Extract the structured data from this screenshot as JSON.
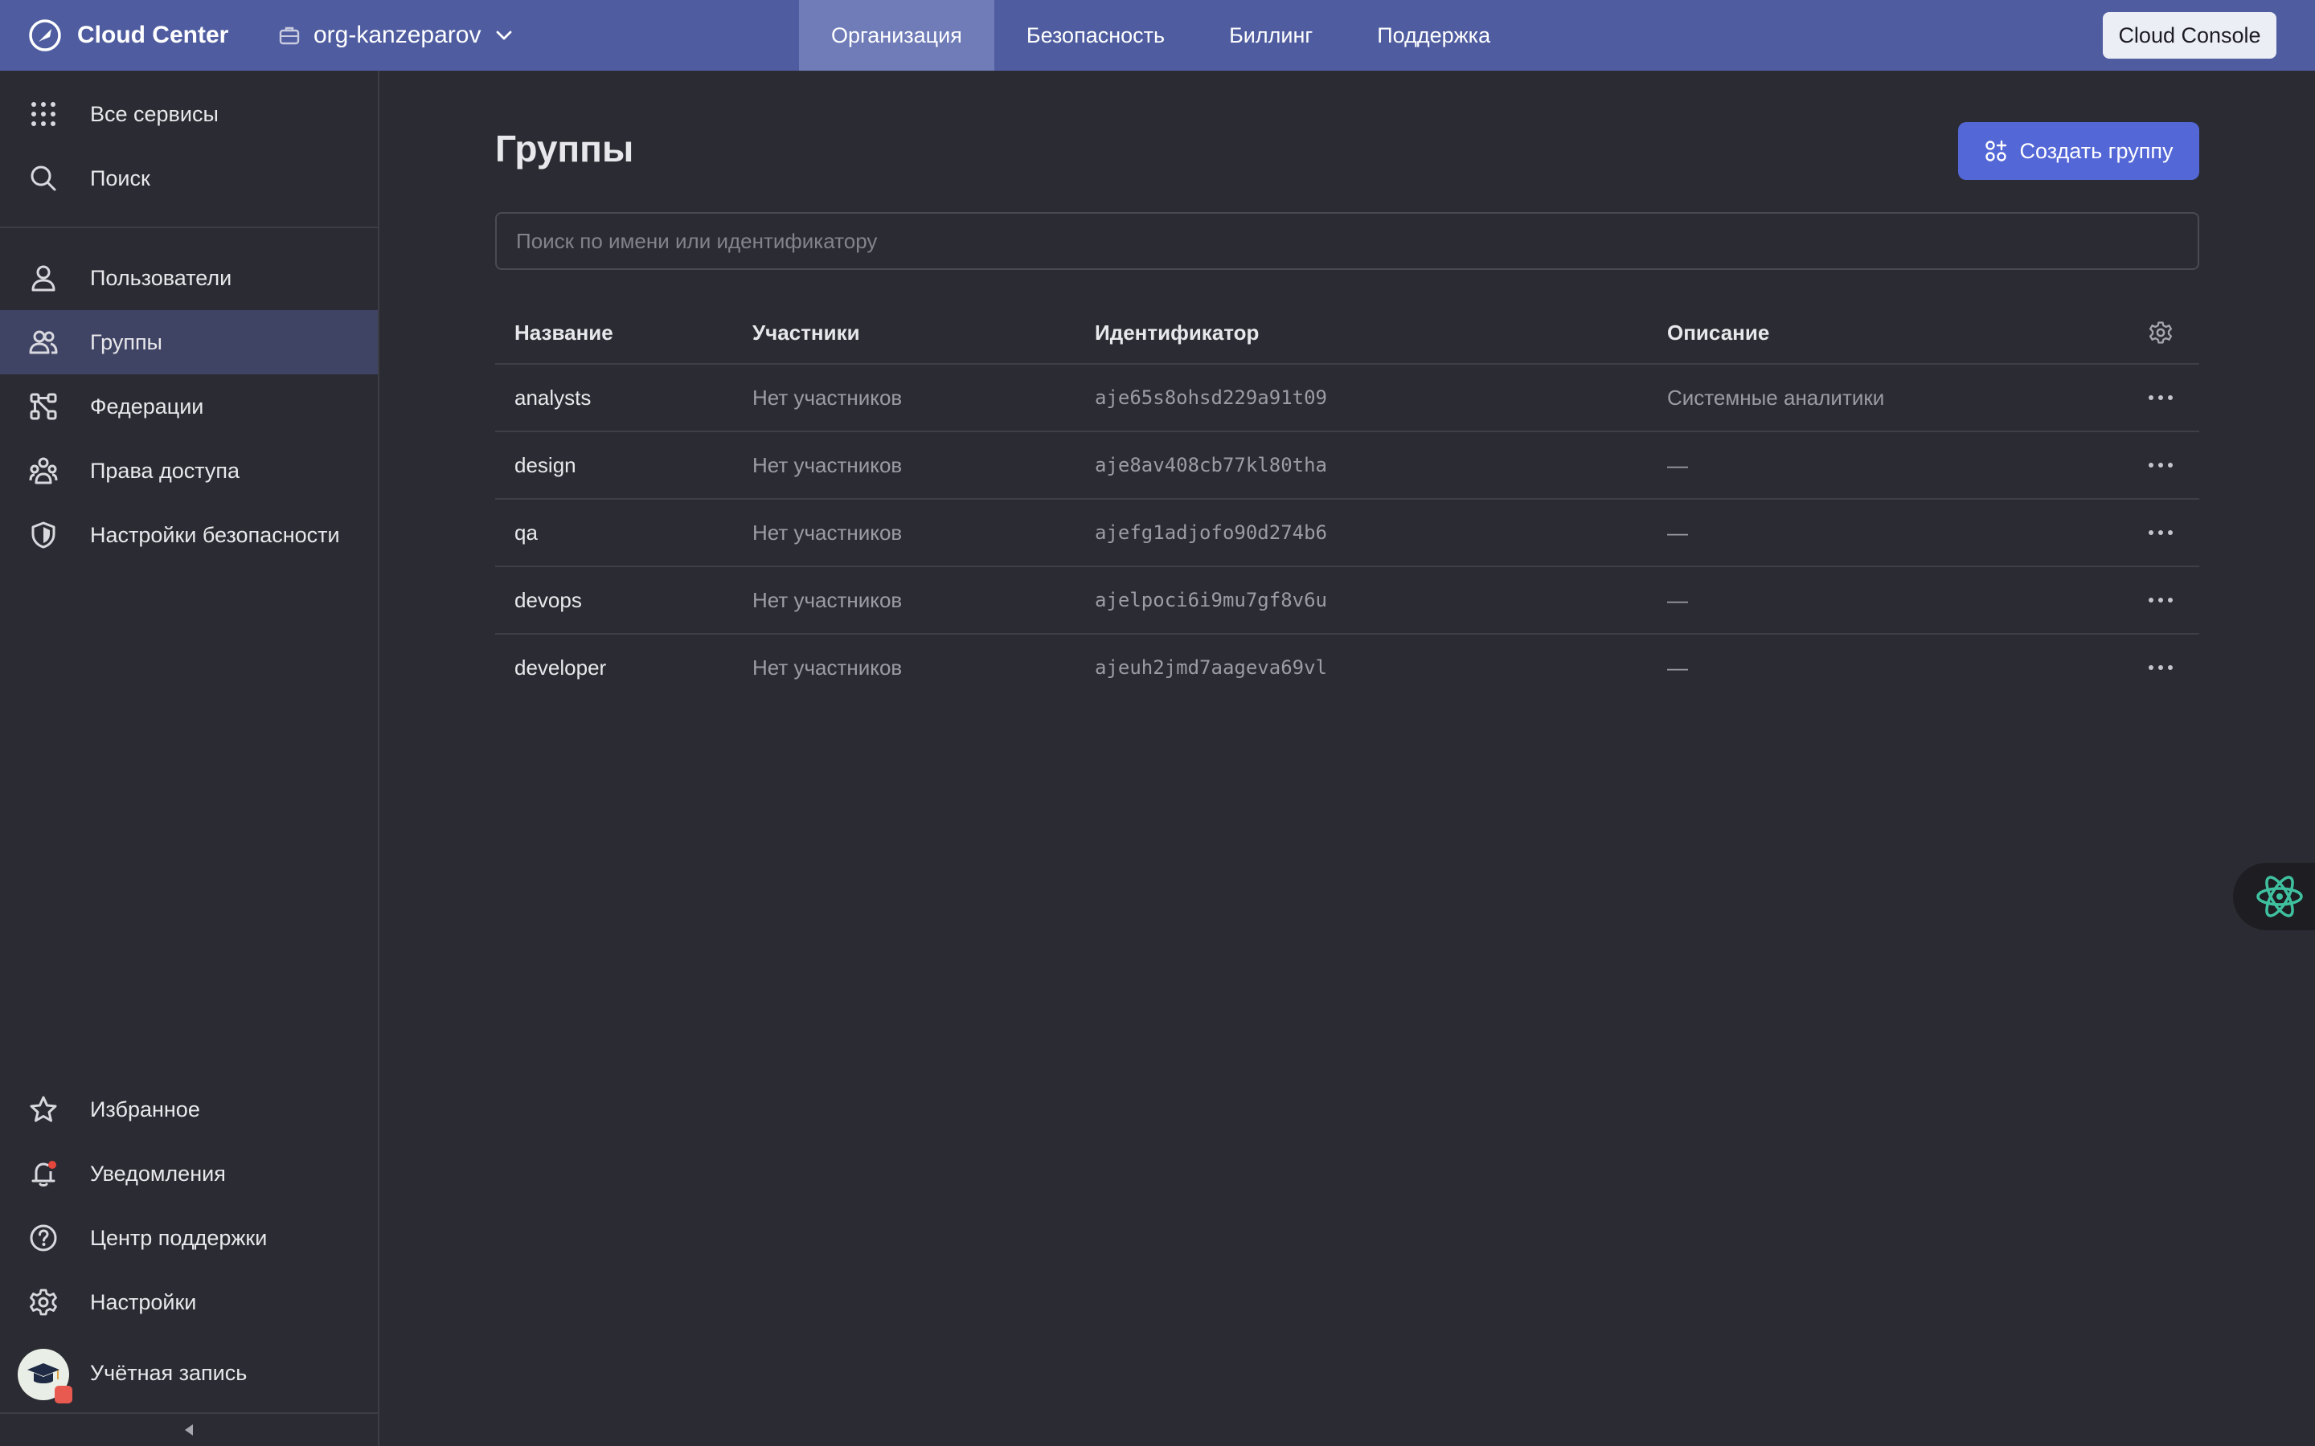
{
  "header": {
    "brand": "Cloud Center",
    "org": "org-kanzeparov",
    "tabs": [
      {
        "label": "Организация",
        "active": true
      },
      {
        "label": "Безопасность",
        "active": false
      },
      {
        "label": "Биллинг",
        "active": false
      },
      {
        "label": "Поддержка",
        "active": false
      }
    ],
    "console_button": "Cloud Console"
  },
  "sidebar": {
    "top_items": [
      {
        "label": "Все сервисы",
        "icon": "grid-icon"
      },
      {
        "label": "Поиск",
        "icon": "search-icon"
      }
    ],
    "items": [
      {
        "label": "Пользователи",
        "icon": "user-icon"
      },
      {
        "label": "Группы",
        "icon": "group-icon",
        "active": true
      },
      {
        "label": "Федерации",
        "icon": "federation-icon"
      },
      {
        "label": "Права доступа",
        "icon": "access-icon"
      },
      {
        "label": "Настройки безопасности",
        "icon": "shield-icon"
      }
    ],
    "bottom_items": [
      {
        "label": "Избранное",
        "icon": "star-icon"
      },
      {
        "label": "Уведомления",
        "icon": "bell-icon"
      },
      {
        "label": "Центр поддержки",
        "icon": "help-icon"
      },
      {
        "label": "Настройки",
        "icon": "gear-icon"
      },
      {
        "label": "Учётная запись",
        "icon": "avatar"
      }
    ]
  },
  "main": {
    "title": "Группы",
    "create_button": "Создать группу",
    "search_placeholder": "Поиск по имени или идентификатору",
    "columns": {
      "name": "Название",
      "members": "Участники",
      "id": "Идентификатор",
      "description": "Описание"
    },
    "rows": [
      {
        "name": "analysts",
        "members": "Нет участников",
        "id": "aje65s8ohsd229a91t09",
        "description": "Системные аналитики"
      },
      {
        "name": "design",
        "members": "Нет участников",
        "id": "aje8av408cb77kl80tha",
        "description": "—"
      },
      {
        "name": "qa",
        "members": "Нет участников",
        "id": "ajefg1adjofo90d274b6",
        "description": "—"
      },
      {
        "name": "devops",
        "members": "Нет участников",
        "id": "ajelpoci6i9mu7gf8v6u",
        "description": "—"
      },
      {
        "name": "developer",
        "members": "Нет участников",
        "id": "ajeuh2jmd7aageva69vl",
        "description": "—"
      }
    ]
  },
  "colors": {
    "topbar": "#4f5da0",
    "active_tab": "#6f7cb8",
    "background": "#2b2b33",
    "sidebar_active": "#3f4464",
    "primary_button": "#5367d6",
    "assistant": "#3fc1a0"
  }
}
